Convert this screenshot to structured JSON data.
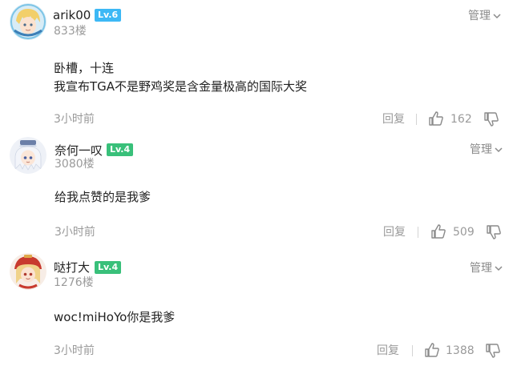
{
  "colors": {
    "level_badge": "#3db8f5",
    "level_badge_green": "#39c07a",
    "muted_text": "#9a9a9a"
  },
  "comments": [
    {
      "username": "arik00",
      "level": "Lv.6",
      "floor": "833楼",
      "manage": "管理",
      "lines": [
        "卧槽，十连",
        "我宣布TGA不是野鸡奖是含金量极高的国际大奖"
      ],
      "time": "3小时前",
      "reply": "回复",
      "likes": "162",
      "avatar_icon": "blonde-character-avatar-icon"
    },
    {
      "username": "奈何一叹",
      "level": "Lv.4",
      "floor": "3080楼",
      "manage": "管理",
      "lines": [
        "给我点赞的是我爹"
      ],
      "time": "3小时前",
      "reply": "回复",
      "likes": "509",
      "avatar_icon": "white-hair-character-avatar-icon"
    },
    {
      "username": "哒打大",
      "level": "Lv.4",
      "floor": "1276楼",
      "manage": "管理",
      "lines": [
        "woc!miHoYo你是我爹"
      ],
      "time": "3小时前",
      "reply": "回复",
      "likes": "1388",
      "avatar_icon": "red-hat-character-avatar-icon"
    }
  ]
}
